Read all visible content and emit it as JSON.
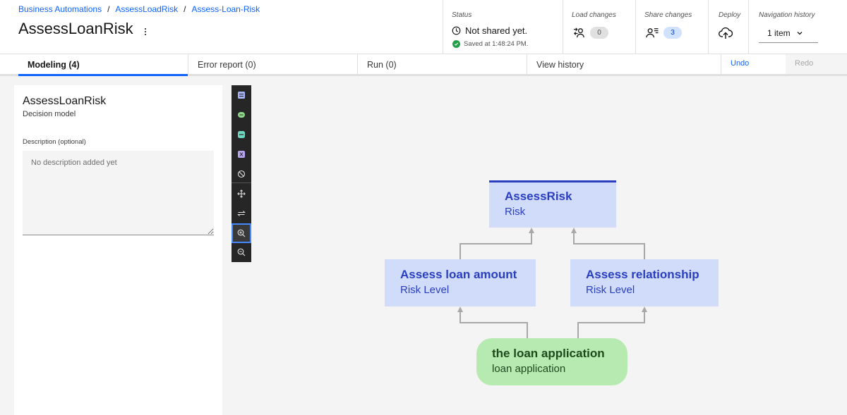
{
  "breadcrumb": {
    "items": [
      "Business Automations",
      "AssessLoadRisk",
      "Assess-Loan-Risk"
    ],
    "separator": "/"
  },
  "page": {
    "title": "AssessLoanRisk"
  },
  "status": {
    "label": "Status",
    "text": "Not shared yet.",
    "saved": "Saved at 1:48:24 PM."
  },
  "load_changes": {
    "label": "Load changes",
    "count": "0"
  },
  "share_changes": {
    "label": "Share changes",
    "count": "3"
  },
  "deploy": {
    "label": "Deploy"
  },
  "navigation_history": {
    "label": "Navigation history",
    "value": "1 item"
  },
  "tabs": [
    {
      "label": "Modeling (4)",
      "active": true
    },
    {
      "label": "Error report (0)",
      "active": false
    },
    {
      "label": "Run (0)",
      "active": false
    },
    {
      "label": "View history",
      "active": false
    }
  ],
  "actions": {
    "undo": "Undo",
    "redo": "Redo"
  },
  "properties": {
    "name": "AssessLoanRisk",
    "type": "Decision model",
    "description_label": "Description (optional)",
    "description_placeholder": "No description added yet"
  },
  "toolbar": {
    "tools": [
      "decision-node-icon",
      "input-data-icon",
      "prediction-node-icon",
      "function-node-icon",
      "hide-node-icon",
      "pan-icon",
      "swap-icon",
      "zoom-in-icon",
      "zoom-out-icon"
    ]
  },
  "diagram": {
    "nodes": [
      {
        "id": "assess-risk",
        "title": "AssessRisk",
        "subtitle": "Risk"
      },
      {
        "id": "assess-loan-amount",
        "title": "Assess loan amount",
        "subtitle": "Risk Level"
      },
      {
        "id": "assess-relationship",
        "title": "Assess relationship",
        "subtitle": "Risk Level"
      },
      {
        "id": "loan-application",
        "title": "the loan application",
        "subtitle": "loan application"
      }
    ]
  },
  "colors": {
    "accent": "#0f62fe",
    "decision_node": "#d0dcfa",
    "decision_text": "#2a3ec0",
    "input_node": "#b7eab0",
    "input_text": "#1d4a1d",
    "success": "#24a148"
  }
}
